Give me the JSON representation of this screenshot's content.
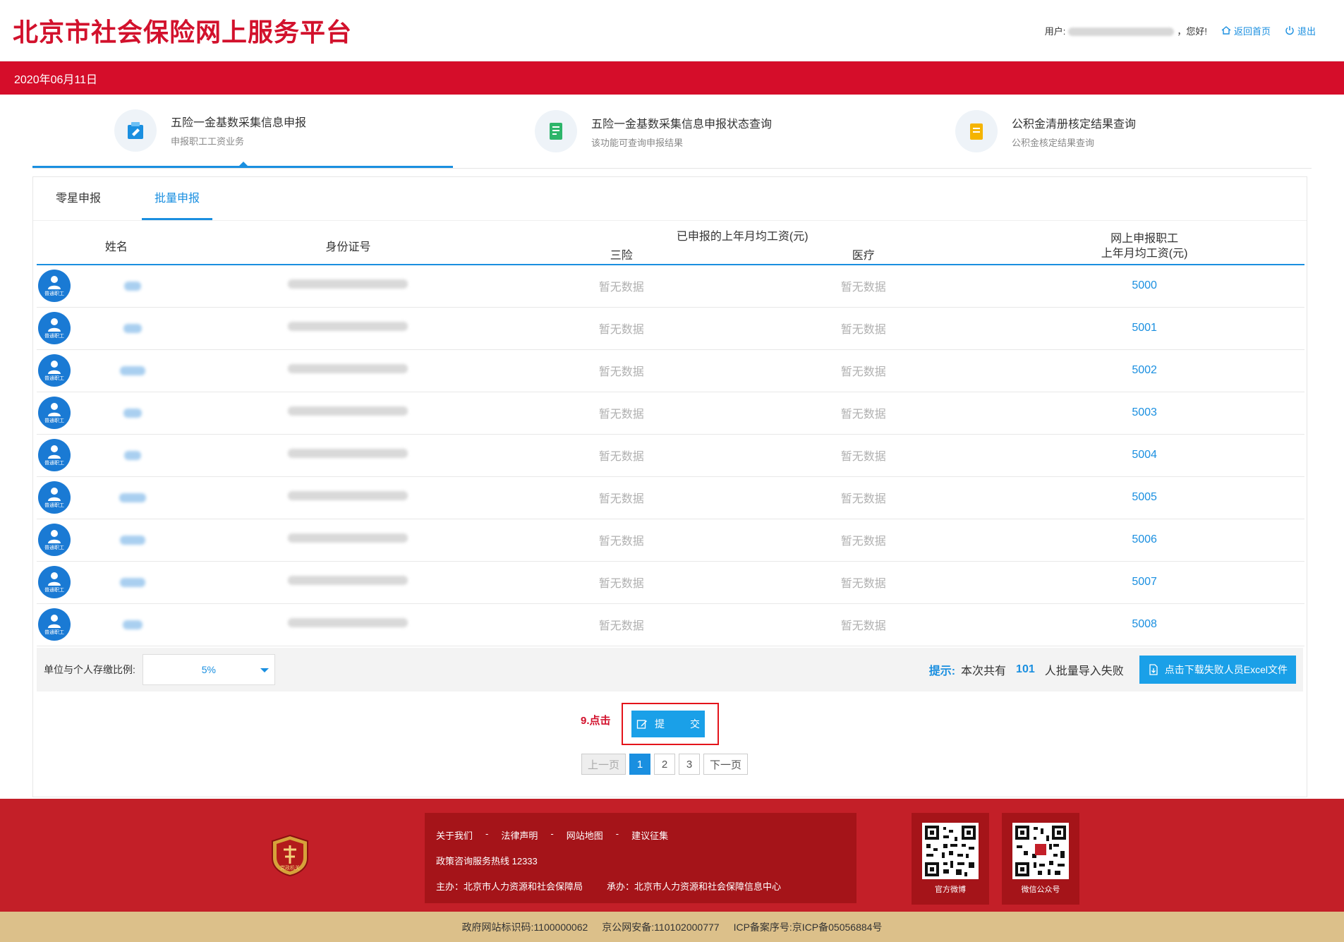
{
  "header": {
    "site_title": "北京市社会保险网上服务平台",
    "user_prefix": "用户:",
    "user_suffix": "，您好!",
    "home_link": "返回首页",
    "logout_link": "退出",
    "date": "2020年06月11日"
  },
  "features": [
    {
      "title": "五险一金基数采集信息申报",
      "subtitle": "申报职工工资业务"
    },
    {
      "title": "五险一金基数采集信息申报状态查询",
      "subtitle": "该功能可查询申报结果"
    },
    {
      "title": "公积金清册核定结果查询",
      "subtitle": "公积金核定结果查询"
    }
  ],
  "subtabs": [
    "零星申报",
    "批量申报"
  ],
  "table": {
    "col_name": "姓名",
    "col_id": "身份证号",
    "col_reported": "已申报的上年月均工资(元)",
    "col_three": "三险",
    "col_medical": "医疗",
    "col_online_line1": "网上申报职工",
    "col_online_line2": "上年月均工资(元)",
    "avatar_label": "普通职工",
    "rows": [
      {
        "three": "暂无数据",
        "medical": "暂无数据",
        "wage": "5000"
      },
      {
        "three": "暂无数据",
        "medical": "暂无数据",
        "wage": "5001"
      },
      {
        "three": "暂无数据",
        "medical": "暂无数据",
        "wage": "5002"
      },
      {
        "three": "暂无数据",
        "medical": "暂无数据",
        "wage": "5003"
      },
      {
        "three": "暂无数据",
        "medical": "暂无数据",
        "wage": "5004"
      },
      {
        "three": "暂无数据",
        "medical": "暂无数据",
        "wage": "5005"
      },
      {
        "three": "暂无数据",
        "medical": "暂无数据",
        "wage": "5006"
      },
      {
        "three": "暂无数据",
        "medical": "暂无数据",
        "wage": "5007"
      },
      {
        "three": "暂无数据",
        "medical": "暂无数据",
        "wage": "5008"
      }
    ]
  },
  "ratio": {
    "label": "单位与个人存缴比例:",
    "value": "5%"
  },
  "hint": {
    "label": "提示:",
    "before": "本次共有",
    "count": "101",
    "after": "人批量导入失败",
    "download": "点击下载失败人员Excel文件"
  },
  "annotation": "9.点击",
  "submit": {
    "label_left": "提",
    "label_right": "交"
  },
  "pager": {
    "prev": "上一页",
    "pages": [
      "1",
      "2",
      "3"
    ],
    "next": "下一页",
    "current": "1"
  },
  "footer": {
    "links": [
      "关于我们",
      "-",
      "法律声明",
      "-",
      "网站地图",
      "-",
      "建议征集"
    ],
    "hotline": "政策咨询服务热线 12333",
    "host": "主办：北京市人力资源和社会保障局",
    "organizer": "承办：北京市人力资源和社会保障信息中心",
    "emblem_text": "党政机关",
    "qr_weibo": "官方微博",
    "qr_wechat": "微信公众号",
    "gov_id": "政府网站标识码:1100000062",
    "police": "京公网安备:110102000777",
    "icp": "ICP备案序号:京ICP备05056884号"
  },
  "colors": {
    "brand_red": "#d50d2a",
    "accent_blue": "#1a8fe0"
  }
}
